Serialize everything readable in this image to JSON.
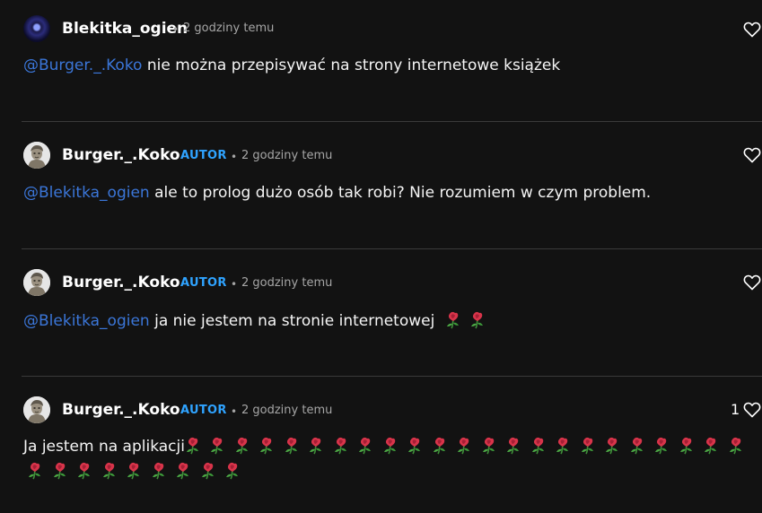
{
  "comments": [
    {
      "author": "Blekitka_ogien",
      "badge": "",
      "dot": "•",
      "time": "2 godziny temu",
      "mention": "@Burger._.Koko",
      "text": " nie można przepisywać na strony internetowe książek",
      "likes": ""
    },
    {
      "author": "Burger._.Koko",
      "badge": "AUTOR",
      "dot": "•",
      "time": "2 godziny temu",
      "mention": "@Blekitka_ogien",
      "text": " ale to prolog dużo osób tak robi? Nie rozumiem w czym problem.",
      "likes": ""
    },
    {
      "author": "Burger._.Koko",
      "badge": "AUTOR",
      "dot": "•",
      "time": "2 godziny temu",
      "mention": "@Blekitka_ogien",
      "text": " ja nie jestem na stronie internetowej",
      "likes": ""
    },
    {
      "author": "Burger._.Koko",
      "badge": "AUTOR",
      "dot": "•",
      "time": "2 godziny temu",
      "mention": "",
      "text": "Ja jestem na aplikacji",
      "likes": "1"
    }
  ],
  "icons": {
    "heart": "heart-icon",
    "rose": "wilted-flower-emoji",
    "avatar_1": "blue-avatar",
    "avatar_2": "burger-avatar"
  },
  "colors": {
    "background": "#121212",
    "mention": "#3b76d8",
    "badge": "#2fa3ff",
    "meta": "#a6a6a6"
  },
  "emoji": {
    "comment3_count": 2,
    "comment4_line1_count": 23,
    "comment4_line2_count": 9
  }
}
